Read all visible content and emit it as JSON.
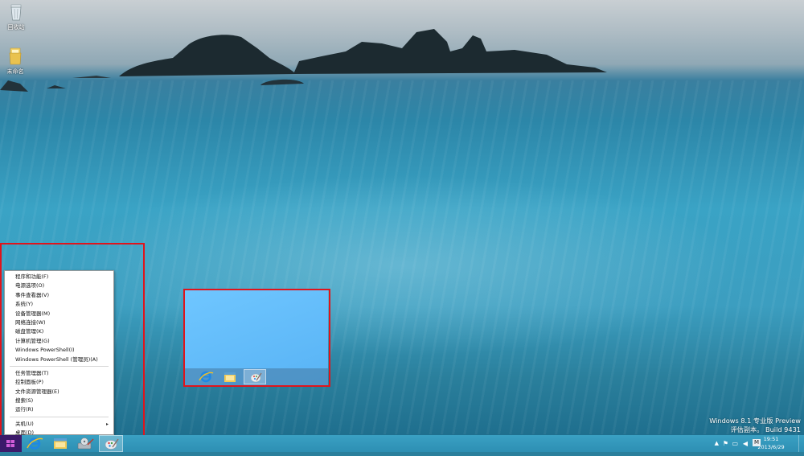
{
  "desktop": {
    "icons": [
      {
        "label": "回收站",
        "icon": "recycle-bin-icon"
      },
      {
        "label": "未命名",
        "icon": "folder-icon"
      }
    ]
  },
  "winx_menu": {
    "group1": [
      "程序和功能(F)",
      "电源选项(O)",
      "事件查看器(V)",
      "系统(Y)",
      "设备管理器(M)",
      "网络连接(W)",
      "磁盘管理(K)",
      "计算机管理(G)",
      "Windows PowerShell(I)",
      "Windows PowerShell (管理员)(A)"
    ],
    "group2": [
      "任务管理器(T)",
      "控制面板(P)",
      "文件资源管理器(E)",
      "搜索(S)",
      "运行(R)"
    ],
    "group3": [
      {
        "label": "关机(U)",
        "submenu_arrow": "▸"
      },
      {
        "label": "桌面(D)"
      }
    ]
  },
  "taskbar": {
    "pinned": [
      {
        "name": "internet-explorer-icon"
      },
      {
        "name": "file-explorer-icon"
      },
      {
        "name": "disk-cleanup-icon"
      },
      {
        "name": "paint-icon"
      }
    ],
    "tray": {
      "input_method": "M",
      "time": "19:51",
      "date": "2013/6/29"
    }
  },
  "watermark": {
    "line1": "Windows 8.1 专业版 Preview",
    "line2": "评估副本。 Build 9431"
  },
  "colors": {
    "highlight_border": "#e0141c",
    "start_button": "#3b1a6a",
    "taskbar": "#3aa0c3"
  }
}
